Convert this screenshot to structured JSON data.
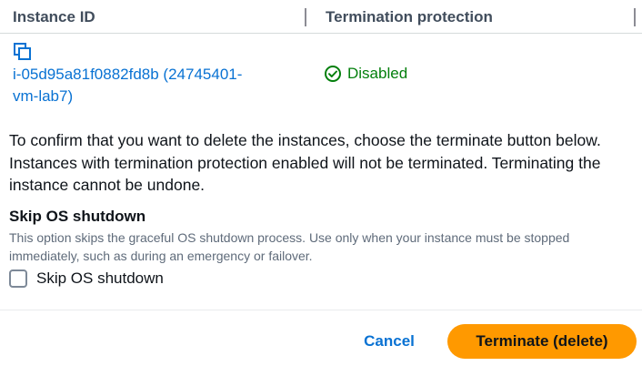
{
  "table": {
    "columns": [
      "Instance ID",
      "Termination protection"
    ],
    "rows": [
      {
        "instance_line1": "i-05d95a81f0882fd8b (24745401-",
        "instance_line2": "vm-lab7)",
        "protection": "Disabled",
        "copy_icon": "copy-icon",
        "status_icon": "check-circle-icon"
      }
    ]
  },
  "confirm_text": "To confirm that you want to delete the instances, choose the terminate button below. Instances with termination protection enabled will not be terminated. Terminating the instance cannot be undone.",
  "skip_os": {
    "heading": "Skip OS shutdown",
    "description": "This option skips the graceful OS shutdown process. Use only when your instance must be stopped immediately, such as during an emergency or failover.",
    "checkbox_label": "Skip OS shutdown",
    "checked": false
  },
  "footer": {
    "cancel_label": "Cancel",
    "terminate_label": "Terminate (delete)"
  },
  "colors": {
    "link": "#0972d3",
    "success": "#037f0c",
    "primary_button": "#ff9900",
    "text": "#0f141a",
    "muted": "#5f6b7a"
  }
}
